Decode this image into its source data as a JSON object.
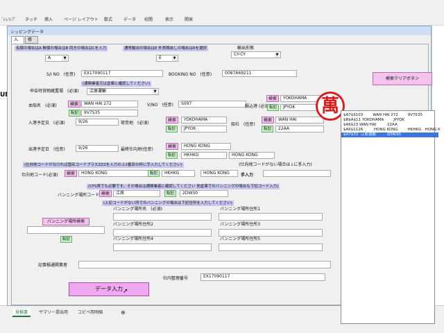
{
  "ribbon": {
    "tabs": [
      "ﾞﾚいﾚﾌﾞ",
      "タッチ",
      "挿入",
      "ページ レイアウト",
      "数式",
      "データ",
      "校閲",
      "表示",
      "開発"
    ]
  },
  "excel": {
    "sheets": [
      "見積書",
      "サマリー提出用",
      "コピペ用明細"
    ],
    "add_sheet": "⊕",
    "left_peek": "UN"
  },
  "form": {
    "title": "シッピングデータ",
    "tabs": [
      "入力",
      "修正"
    ],
    "notes": {
      "incoterm": "有償の場合はA 無償の場合はB 同方の場合はCを入力",
      "export_type": "通常輸出の場合はE 外貨積戻しの場合はRを選択",
      "customs_confirm": "(通関業者又は倉庫に確認してください)",
      "dest_code_hint": "(仕向地コードがなければ国名コードプラスZZZを入力の上2番目の枠に手入力してください)",
      "dest_manual_hint": "(仕向地コードがない場合は↓に手入力)",
      "cfs_hint": "(CFS貨でも必要です。その場合は通関業者に確認してください 他倉庫でのバンニングの場合も下記コード入力)",
      "vanning_addr_hint": "(上記コードがない所でのバンニングの場合は下記住所を入力してください)"
    },
    "labels": {
      "transport": "輸出形態",
      "si_no": "S/I NO　(任意)",
      "booking_no": "BOOKING NO　(任意)",
      "customs_warehouse": "申告特貨物蔵置場　(必須)",
      "vessel": "本船名　(必須)",
      "vno": "V/NO　(任意)",
      "loading_port": "積込港 (必須)",
      "entry_date": "入港予定日　(必須)",
      "load_place": "荷受地　(必須)",
      "ship_company": "船社　(任意)",
      "departure_date": "出港予定日　(任意)",
      "final_dest": "最終仕向地(任意)",
      "dest_code": "仕向地コード(必須)",
      "manual_input": "手入力",
      "vanning_code": "バンニング場所コード",
      "vanning_name": "バンニング場所名　(必須)",
      "vanning_addr1": "バンニング場所住所1",
      "vanning_addr2": "バンニング場所住所2",
      "vanning_addr3": "バンニング場所住所3",
      "vanning_addr4": "バンニング場所住所4",
      "vanning_addr5": "バンニング場所住所5",
      "customs_agent": "記事積通関業者",
      "internal_no": "社内整理番号"
    },
    "values": {
      "incoterm": "A",
      "export_type": "E",
      "transport": "CY-CY",
      "si_no": "EX17090117",
      "booking_no": "0087A69211",
      "customs_warehouse": "江原運輸",
      "vessel": "WAN HAI 272",
      "vessel_code": "9V7535",
      "vno": "S097",
      "loading_port_name": "YOKOHAMA",
      "loading_port_code": "JPYOK",
      "entry_date": "9/26",
      "load_place_name": "YOKOHAMA",
      "load_place_code": "JPYOK",
      "ship_company_name": "WAN HAI",
      "ship_company_code": "22AA",
      "departure_date": "9/26",
      "final_dest_name": "HONG KONG",
      "final_dest_code": "HKHKG",
      "final_dest_name2": "HONG KONG",
      "dest_name": "HONG KONG",
      "dest_code": "HKHKG",
      "dest_manual": "HONG KONG",
      "vanning_name": "江原",
      "vanning_code": "2DW30",
      "internal_no": "EX17090117"
    },
    "buttons": {
      "search": "検索",
      "transcribe": "転記",
      "vanning_search": "バンニング場所検索",
      "clear_search": "検索クリアボタン",
      "data_input": "データ入力"
    },
    "logo_char": "萬",
    "list_rows": [
      "$A7$9103        WAN HAI 272        9V7535",
      "$B$A$11 YOKOHAMA        JPYOK",
      "$A6$23 WAN HAI         22AA",
      "$A6$1126         HONG KONG        HKHKG   HONG K",
      "$A7$33  江原運輸         2DW30"
    ]
  }
}
